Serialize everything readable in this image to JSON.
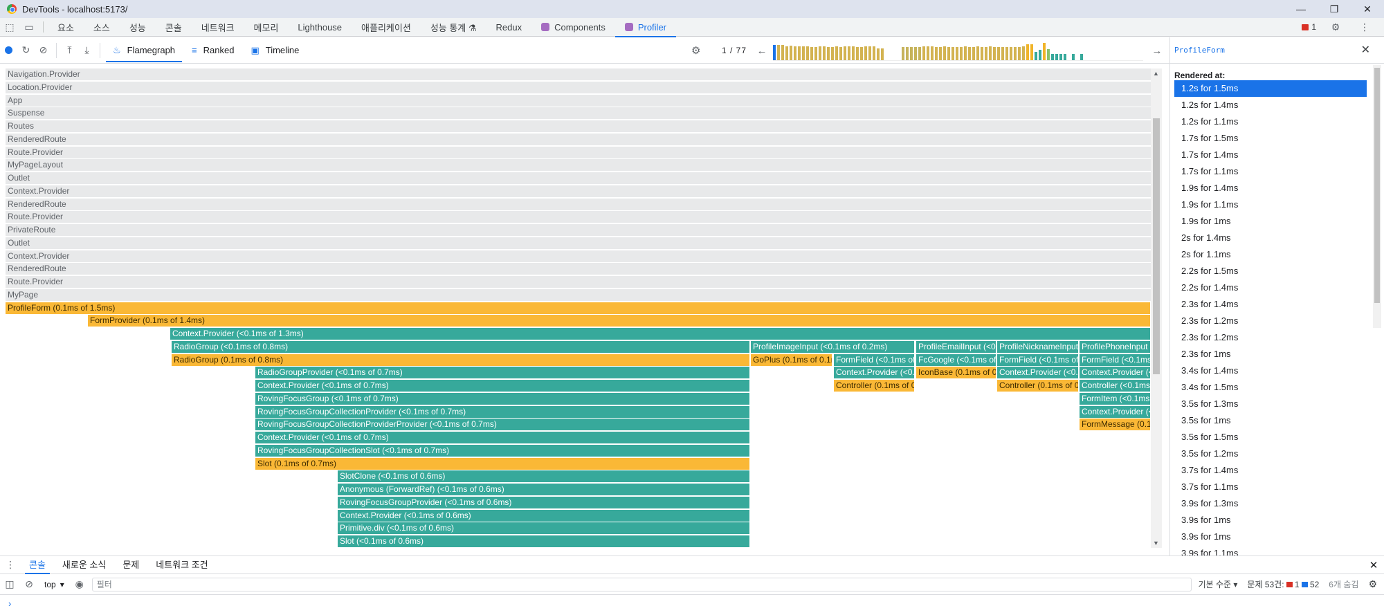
{
  "window": {
    "title": "DevTools - localhost:5173/"
  },
  "tabs": [
    {
      "label": "요소",
      "active": false
    },
    {
      "label": "소스",
      "active": false
    },
    {
      "label": "성능",
      "active": false
    },
    {
      "label": "콘솔",
      "active": false
    },
    {
      "label": "네트워크",
      "active": false
    },
    {
      "label": "메모리",
      "active": false
    },
    {
      "label": "Lighthouse",
      "active": false
    },
    {
      "label": "애플리케이션",
      "active": false
    },
    {
      "label": "성능 통계 ⚗",
      "active": false
    },
    {
      "label": "Redux",
      "active": false
    },
    {
      "label": "Components",
      "active": false
    },
    {
      "label": "Profiler",
      "active": true
    }
  ],
  "tabbar": {
    "error_count": "1"
  },
  "profiler": {
    "views": [
      {
        "label": "Flamegraph",
        "icon": "flame-icon",
        "active": true
      },
      {
        "label": "Ranked",
        "icon": "ranked-icon",
        "active": false
      },
      {
        "label": "Timeline",
        "icon": "calendar-icon",
        "active": false
      }
    ],
    "commit_index": "1",
    "commit_total": "77",
    "commit_bars": [
      {
        "h": 0.75,
        "c": "#1a73e8"
      },
      {
        "h": 0.75,
        "c": "#d3b351"
      },
      {
        "h": 0.75,
        "c": "#d3b351"
      },
      {
        "h": 0.7,
        "c": "#d3b351"
      },
      {
        "h": 0.72,
        "c": "#d3b351"
      },
      {
        "h": 0.7,
        "c": "#d3b351"
      },
      {
        "h": 0.68,
        "c": "#d3b351"
      },
      {
        "h": 0.68,
        "c": "#d3b351"
      },
      {
        "h": 0.7,
        "c": "#d3b351"
      },
      {
        "h": 0.66,
        "c": "#d3b351"
      },
      {
        "h": 0.66,
        "c": "#d3b351"
      },
      {
        "h": 0.7,
        "c": "#d3b351"
      },
      {
        "h": 0.7,
        "c": "#d3b351"
      },
      {
        "h": 0.66,
        "c": "#d3b351"
      },
      {
        "h": 0.66,
        "c": "#d3b351"
      },
      {
        "h": 0.7,
        "c": "#d3b351"
      },
      {
        "h": 0.66,
        "c": "#d3b351"
      },
      {
        "h": 0.7,
        "c": "#d3b351"
      },
      {
        "h": 0.7,
        "c": "#d3b351"
      },
      {
        "h": 0.68,
        "c": "#d3b351"
      },
      {
        "h": 0.66,
        "c": "#d3b351"
      },
      {
        "h": 0.66,
        "c": "#d3b351"
      },
      {
        "h": 0.7,
        "c": "#d3b351"
      },
      {
        "h": 0.7,
        "c": "#d3b351"
      },
      {
        "h": 0.7,
        "c": "#d3b351"
      },
      {
        "h": 0.6,
        "c": "#d3b351"
      },
      {
        "h": 0.6,
        "c": "#d3b351"
      },
      {
        "h": 0.0,
        "c": "#ffffff"
      },
      {
        "h": 0.0,
        "c": "#ffffff"
      },
      {
        "h": 0.0,
        "c": "#ffffff"
      },
      {
        "h": 0.0,
        "c": "#ffffff"
      },
      {
        "h": 0.66,
        "c": "#c6b35b"
      },
      {
        "h": 0.66,
        "c": "#c6b35b"
      },
      {
        "h": 0.66,
        "c": "#c6b35b"
      },
      {
        "h": 0.66,
        "c": "#c6b35b"
      },
      {
        "h": 0.66,
        "c": "#c6b35b"
      },
      {
        "h": 0.7,
        "c": "#d3b351"
      },
      {
        "h": 0.7,
        "c": "#d3b351"
      },
      {
        "h": 0.7,
        "c": "#d3b351"
      },
      {
        "h": 0.66,
        "c": "#d3b351"
      },
      {
        "h": 0.66,
        "c": "#d3b351"
      },
      {
        "h": 0.7,
        "c": "#d3b351"
      },
      {
        "h": 0.66,
        "c": "#d3b351"
      },
      {
        "h": 0.66,
        "c": "#d3b351"
      },
      {
        "h": 0.66,
        "c": "#d3b351"
      },
      {
        "h": 0.66,
        "c": "#d3b351"
      },
      {
        "h": 0.7,
        "c": "#d3b351"
      },
      {
        "h": 0.66,
        "c": "#d3b351"
      },
      {
        "h": 0.66,
        "c": "#d3b351"
      },
      {
        "h": 0.7,
        "c": "#d3b351"
      },
      {
        "h": 0.66,
        "c": "#d3b351"
      },
      {
        "h": 0.66,
        "c": "#d3b351"
      },
      {
        "h": 0.7,
        "c": "#d3b351"
      },
      {
        "h": 0.66,
        "c": "#d3b351"
      },
      {
        "h": 0.66,
        "c": "#d3b351"
      },
      {
        "h": 0.66,
        "c": "#d3b351"
      },
      {
        "h": 0.66,
        "c": "#d3b351"
      },
      {
        "h": 0.66,
        "c": "#d3b351"
      },
      {
        "h": 0.66,
        "c": "#d3b351"
      },
      {
        "h": 0.66,
        "c": "#d3b351"
      },
      {
        "h": 0.7,
        "c": "#d3b351"
      },
      {
        "h": 0.8,
        "c": "#f0b429"
      },
      {
        "h": 0.8,
        "c": "#f0b429"
      },
      {
        "h": 0.4,
        "c": "#37a99b"
      },
      {
        "h": 0.5,
        "c": "#37a99b"
      },
      {
        "h": 0.85,
        "c": "#f0b429"
      },
      {
        "h": 0.55,
        "c": "#8cc26b"
      },
      {
        "h": 0.3,
        "c": "#37a99b"
      },
      {
        "h": 0.3,
        "c": "#37a99b"
      },
      {
        "h": 0.3,
        "c": "#37a99b"
      },
      {
        "h": 0.3,
        "c": "#37a99b"
      },
      {
        "h": 0.0,
        "c": "#ffffff"
      },
      {
        "h": 0.3,
        "c": "#37a99b"
      },
      {
        "h": 0.0,
        "c": "#ffffff"
      },
      {
        "h": 0.3,
        "c": "#37a99b"
      },
      {
        "h": 0.0,
        "c": "#ffffff"
      },
      {
        "h": 0.0,
        "c": "#ffffff"
      }
    ],
    "flamegraph": {
      "static_rows": [
        "Navigation.Provider",
        "Location.Provider",
        "App",
        "Suspense",
        "Routes",
        "RenderedRoute",
        "Route.Provider",
        "MyPageLayout",
        "Outlet",
        "Context.Provider",
        "RenderedRoute",
        "Route.Provider",
        "PrivateRoute",
        "Outlet",
        "Context.Provider",
        "RenderedRoute",
        "Route.Provider",
        "MyPage"
      ],
      "bars": [
        {
          "d": 18,
          "s": 0.0,
          "e": 1.0,
          "t": "amber",
          "label": "ProfileForm (0.1ms of 1.5ms)"
        },
        {
          "d": 19,
          "s": 0.072,
          "e": 1.0,
          "t": "amber",
          "label": "FormProvider (0.1ms of 1.4ms)"
        },
        {
          "d": 20,
          "s": 0.144,
          "e": 1.0,
          "t": "teal",
          "label": "Context.Provider (<0.1ms of 1.3ms)"
        },
        {
          "d": 21,
          "s": 0.145,
          "e": 0.65,
          "t": "teal",
          "label": "RadioGroup (<0.1ms of 0.8ms)"
        },
        {
          "d": 21,
          "s": 0.651,
          "e": 0.794,
          "t": "teal",
          "label": "ProfileImageInput (<0.1ms of 0.2ms)"
        },
        {
          "d": 21,
          "s": 0.795,
          "e": 0.865,
          "t": "teal",
          "label": "ProfileEmailInput (<0.1ms of 0.1ms)"
        },
        {
          "d": 21,
          "s": 0.866,
          "e": 0.937,
          "t": "teal",
          "label": "ProfileNicknameInput (<0.1ms of 0.1ms)"
        },
        {
          "d": 21,
          "s": 0.938,
          "e": 1.0,
          "t": "teal",
          "label": "ProfilePhoneInput (<0.1ms of 0.1ms)"
        },
        {
          "d": 22,
          "s": 0.145,
          "e": 0.65,
          "t": "amber",
          "label": "RadioGroup (0.1ms of 0.8ms)"
        },
        {
          "d": 22,
          "s": 0.651,
          "e": 0.722,
          "t": "amber",
          "label": "GoPlus (0.1ms of 0.1ms)"
        },
        {
          "d": 22,
          "s": 0.723,
          "e": 0.794,
          "t": "teal",
          "label": "FormField (<0.1ms of 0.1ms)"
        },
        {
          "d": 22,
          "s": 0.795,
          "e": 0.865,
          "t": "teal",
          "label": "FcGoogle (<0.1ms of 0.1ms)"
        },
        {
          "d": 22,
          "s": 0.866,
          "e": 0.937,
          "t": "teal",
          "label": "FormField (<0.1ms of 0.1ms)"
        },
        {
          "d": 22,
          "s": 0.938,
          "e": 1.0,
          "t": "teal",
          "label": "FormField (<0.1ms of 0.1ms)"
        },
        {
          "d": 23,
          "s": 0.218,
          "e": 0.65,
          "t": "teal",
          "label": "RadioGroupProvider (<0.1ms of 0.7ms)"
        },
        {
          "d": 23,
          "s": 0.723,
          "e": 0.794,
          "t": "teal",
          "label": "Context.Provider (<0.1ms of 0.1ms)"
        },
        {
          "d": 23,
          "s": 0.795,
          "e": 0.865,
          "t": "amber",
          "label": "IconBase (0.1ms of 0.1ms)"
        },
        {
          "d": 23,
          "s": 0.866,
          "e": 0.937,
          "t": "teal",
          "label": "Context.Provider (<0.1ms of 0.1ms)"
        },
        {
          "d": 23,
          "s": 0.938,
          "e": 1.0,
          "t": "teal",
          "label": "Context.Provider (<0.1ms of 0.1ms)"
        },
        {
          "d": 24,
          "s": 0.218,
          "e": 0.65,
          "t": "teal",
          "label": "Context.Provider (<0.1ms of 0.7ms)"
        },
        {
          "d": 24,
          "s": 0.723,
          "e": 0.794,
          "t": "amber",
          "label": "Controller (0.1ms of 0.1ms)"
        },
        {
          "d": 24,
          "s": 0.866,
          "e": 0.937,
          "t": "amber",
          "label": "Controller (0.1ms of 0.1ms)"
        },
        {
          "d": 24,
          "s": 0.938,
          "e": 1.0,
          "t": "teal",
          "label": "Controller (<0.1ms of 0.1ms)"
        },
        {
          "d": 25,
          "s": 0.218,
          "e": 0.65,
          "t": "teal",
          "label": "RovingFocusGroup (<0.1ms of 0.7ms)"
        },
        {
          "d": 25,
          "s": 0.938,
          "e": 1.0,
          "t": "teal",
          "label": "FormItem (<0.1ms of 0.1ms)"
        },
        {
          "d": 26,
          "s": 0.218,
          "e": 0.65,
          "t": "teal",
          "label": "RovingFocusGroupCollectionProvider (<0.1ms of 0.7ms)"
        },
        {
          "d": 26,
          "s": 0.938,
          "e": 1.0,
          "t": "teal",
          "label": "Context.Provider (<0.1ms of 0.1ms)"
        },
        {
          "d": 27,
          "s": 0.218,
          "e": 0.65,
          "t": "teal",
          "label": "RovingFocusGroupCollectionProviderProvider (<0.1ms of 0.7ms)"
        },
        {
          "d": 27,
          "s": 0.938,
          "e": 1.0,
          "t": "amber",
          "label": "FormMessage (0.1ms of 0.1ms)"
        },
        {
          "d": 28,
          "s": 0.218,
          "e": 0.65,
          "t": "teal",
          "label": "Context.Provider (<0.1ms of 0.7ms)"
        },
        {
          "d": 29,
          "s": 0.218,
          "e": 0.65,
          "t": "teal",
          "label": "RovingFocusGroupCollectionSlot (<0.1ms of 0.7ms)"
        },
        {
          "d": 30,
          "s": 0.218,
          "e": 0.65,
          "t": "amber",
          "label": "Slot (0.1ms of 0.7ms)"
        },
        {
          "d": 31,
          "s": 0.29,
          "e": 0.65,
          "t": "teal",
          "label": "SlotClone (<0.1ms of 0.6ms)"
        },
        {
          "d": 32,
          "s": 0.29,
          "e": 0.65,
          "t": "teal",
          "label": "Anonymous (ForwardRef) (<0.1ms of 0.6ms)"
        },
        {
          "d": 33,
          "s": 0.29,
          "e": 0.65,
          "t": "teal",
          "label": "RovingFocusGroupProvider (<0.1ms of 0.6ms)"
        },
        {
          "d": 34,
          "s": 0.29,
          "e": 0.65,
          "t": "teal",
          "label": "Context.Provider (<0.1ms of 0.6ms)"
        },
        {
          "d": 35,
          "s": 0.29,
          "e": 0.65,
          "t": "teal",
          "label": "Primitive.div (<0.1ms of 0.6ms)"
        },
        {
          "d": 36,
          "s": 0.29,
          "e": 0.65,
          "t": "teal",
          "label": "Slot (<0.1ms of 0.6ms)"
        },
        {
          "d": 37,
          "s": 0.29,
          "e": 0.65,
          "t": "teal",
          "label": ""
        }
      ]
    }
  },
  "sidebar": {
    "component": "ProfileForm",
    "rendered_at_label": "Rendered at:",
    "renders": [
      "1.2s for 1.5ms",
      "1.2s for 1.4ms",
      "1.2s for 1.1ms",
      "1.7s for 1.5ms",
      "1.7s for 1.4ms",
      "1.7s for 1.1ms",
      "1.9s for 1.4ms",
      "1.9s for 1.1ms",
      "1.9s for 1ms",
      "2s for 1.4ms",
      "2s for 1.1ms",
      "2.2s for 1.5ms",
      "2.2s for 1.4ms",
      "2.3s for 1.4ms",
      "2.3s for 1.2ms",
      "2.3s for 1.2ms",
      "2.3s for 1ms",
      "3.4s for 1.4ms",
      "3.4s for 1.5ms",
      "3.5s for 1.3ms",
      "3.5s for 1ms",
      "3.5s for 1.5ms",
      "3.5s for 1.2ms",
      "3.7s for 1.4ms",
      "3.7s for 1.1ms",
      "3.9s for 1.3ms",
      "3.9s for 1ms",
      "3.9s for 1ms",
      "3.9s for 1.1ms"
    ],
    "selected_index": 0
  },
  "drawer": {
    "tabs": [
      {
        "label": "콘솔",
        "active": true
      },
      {
        "label": "새로운 소식",
        "active": false
      },
      {
        "label": "문제",
        "active": false
      },
      {
        "label": "네트워크 조건",
        "active": false
      }
    ],
    "context": "top",
    "filter_placeholder": "필터",
    "level": "기본 수준",
    "issues_label": "문제 53건:",
    "issues_errors": "1",
    "issues_info": "52",
    "hidden": "6개 숨김",
    "prompt": "›"
  },
  "colors": {
    "teal": "#37a99b",
    "amber": "#fab836",
    "gray": "#e8e9ea",
    "accent": "#1a73e8"
  }
}
